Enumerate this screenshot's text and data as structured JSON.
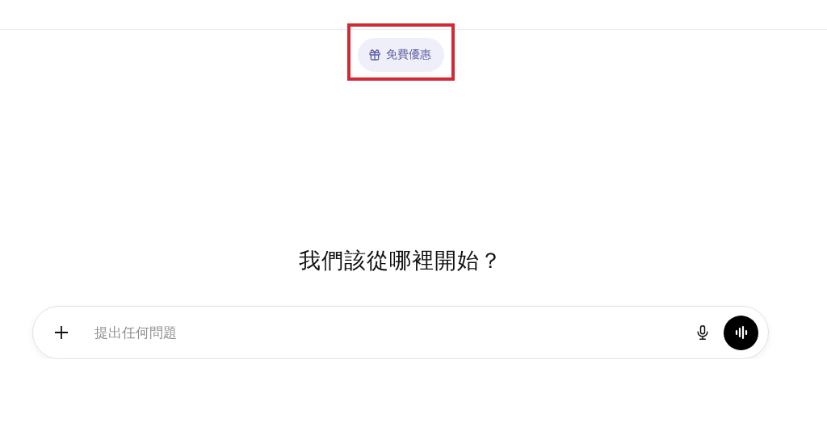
{
  "promo": {
    "label": "免費優惠",
    "highlighted": true
  },
  "heading": "我們該從哪裡開始？",
  "composer": {
    "placeholder": "提出任何問題"
  }
}
